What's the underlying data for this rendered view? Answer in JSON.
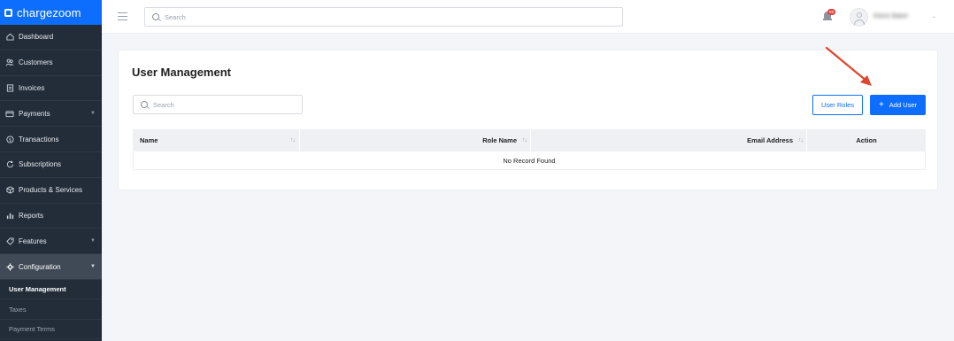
{
  "brand": {
    "name": "chargezoom",
    "color": "#0d6efd"
  },
  "sidebar": {
    "items": [
      {
        "label": "Dashboard",
        "icon": "home-icon"
      },
      {
        "label": "Customers",
        "icon": "users-icon"
      },
      {
        "label": "Invoices",
        "icon": "invoice-icon"
      },
      {
        "label": "Payments",
        "icon": "wallet-icon",
        "has_caret": true
      },
      {
        "label": "Transactions",
        "icon": "dollar-icon"
      },
      {
        "label": "Subscriptions",
        "icon": "refresh-icon"
      },
      {
        "label": "Products & Services",
        "icon": "box-icon"
      },
      {
        "label": "Reports",
        "icon": "bar-chart-icon"
      },
      {
        "label": "Features",
        "icon": "tag-icon",
        "has_caret": true
      },
      {
        "label": "Configuration",
        "icon": "gear-icon",
        "has_caret": true,
        "active": true
      }
    ],
    "subitems": [
      {
        "label": "User Management",
        "active": true
      },
      {
        "label": "Taxes"
      },
      {
        "label": "Payment Terms"
      }
    ]
  },
  "topbar": {
    "search_placeholder": "Search",
    "notification_count": "99",
    "user_name": "Kelvin Baker"
  },
  "page": {
    "title": "User Management",
    "search_placeholder": "Search",
    "user_roles_label": "User Roles",
    "add_user_label": "Add User"
  },
  "table": {
    "columns": [
      "Name",
      "Role Name",
      "Email Address",
      "Action"
    ],
    "empty_text": "No Record Found"
  },
  "colors": {
    "sidebar_bg": "#232d39",
    "accent": "#0d6efd",
    "annotation_arrow": "#e0452f"
  }
}
